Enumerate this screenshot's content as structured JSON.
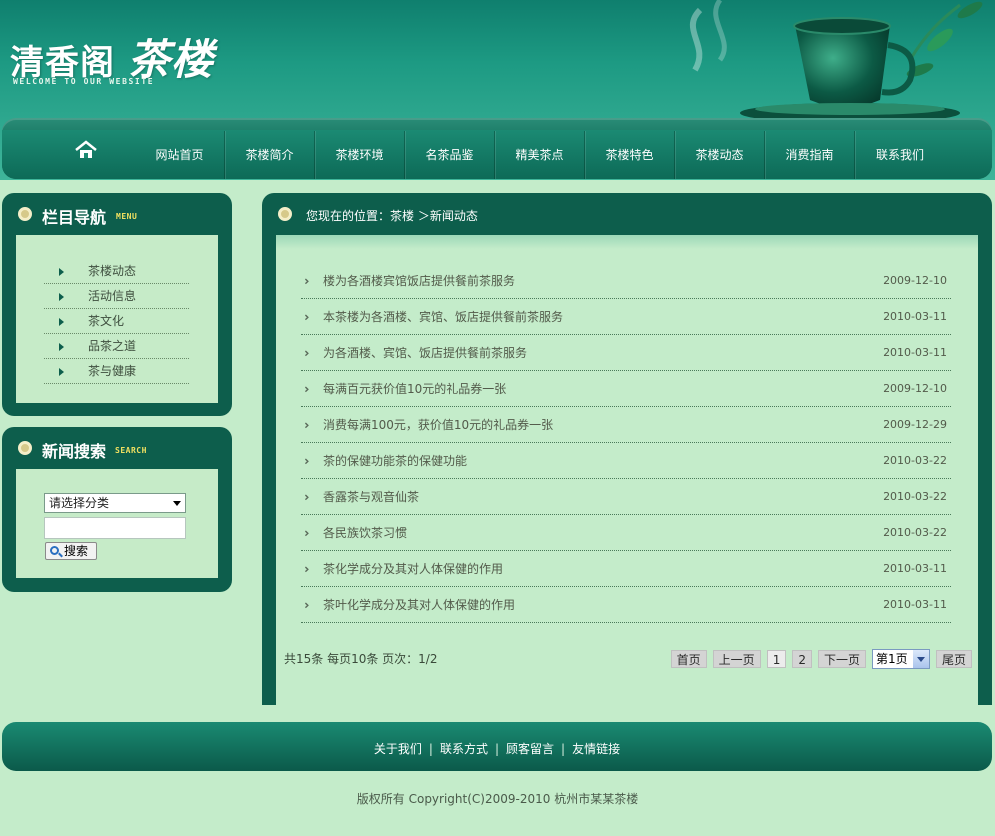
{
  "header": {
    "logo_main": "清香阁",
    "logo_big": "茶楼",
    "logo_sub": "WELCOME TO OUR WEBSITE",
    "accent_color": "#0d5e4c"
  },
  "nav": {
    "home_icon": "home-icon",
    "items": [
      {
        "label": "网站首页"
      },
      {
        "label": "茶楼简介"
      },
      {
        "label": "茶楼环境"
      },
      {
        "label": "名茶品鉴"
      },
      {
        "label": "精美茶点"
      },
      {
        "label": "茶楼特色"
      },
      {
        "label": "茶楼动态"
      },
      {
        "label": "消费指南"
      },
      {
        "label": "联系我们"
      }
    ]
  },
  "sidebar": {
    "menu": {
      "title": "栏目导航",
      "title_en": "MENU",
      "items": [
        {
          "label": "茶楼动态"
        },
        {
          "label": "活动信息"
        },
        {
          "label": "茶文化"
        },
        {
          "label": "品茶之道"
        },
        {
          "label": "茶与健康"
        }
      ]
    },
    "search": {
      "title": "新闻搜索",
      "title_en": "SEARCH",
      "category_selected": "请选择分类",
      "keyword_value": "",
      "button_label": "搜索"
    }
  },
  "main": {
    "breadcrumb": "您现在的位置：茶楼 ＞新闻动态",
    "news": [
      {
        "title": "楼为各酒楼宾馆饭店提供餐前茶服务",
        "date": "2009-12-10"
      },
      {
        "title": "本茶楼为各酒楼、宾馆、饭店提供餐前茶服务",
        "date": "2010-03-11"
      },
      {
        "title": "为各酒楼、宾馆、饭店提供餐前茶服务",
        "date": "2010-03-11"
      },
      {
        "title": "每满百元获价值10元的礼品券一张",
        "date": "2009-12-10"
      },
      {
        "title": "消费每满100元，获价值10元的礼品券一张",
        "date": "2009-12-29"
      },
      {
        "title": "茶的保健功能茶的保健功能",
        "date": "2010-03-22"
      },
      {
        "title": "香露茶与观音仙茶",
        "date": "2010-03-22"
      },
      {
        "title": "各民族饮茶习惯",
        "date": "2010-03-22"
      },
      {
        "title": "茶化学成分及其对人体保健的作用",
        "date": "2010-03-11"
      },
      {
        "title": "茶叶化学成分及其对人体保健的作用",
        "date": "2010-03-11"
      }
    ],
    "pager": {
      "info": "共15条  每页10条  页次：1/2",
      "first": "首页",
      "prev": "上一页",
      "pages": [
        "1",
        "2"
      ],
      "next": "下一页",
      "select_value": "第1页",
      "last": "尾页"
    }
  },
  "footer": {
    "links": [
      {
        "label": "关于我们"
      },
      {
        "label": "联系方式"
      },
      {
        "label": "顾客留言"
      },
      {
        "label": "友情链接"
      }
    ],
    "separator": "|",
    "copyright": "版权所有  Copyright(C)2009-2010 杭州市某某茶楼"
  }
}
